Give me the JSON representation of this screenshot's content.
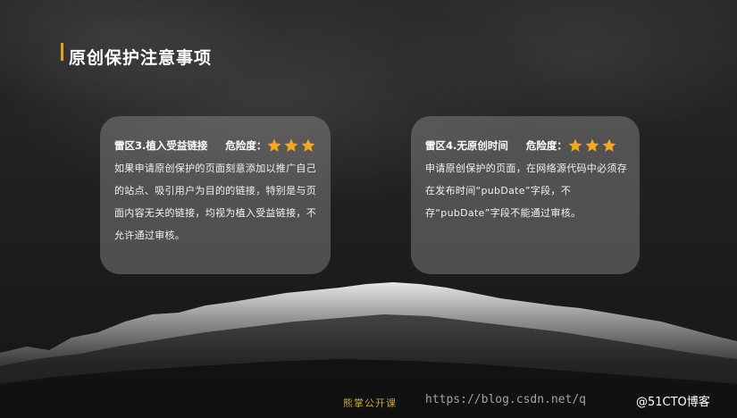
{
  "slide": {
    "title": "原创保护注意事项",
    "accent_color": "#e0a020",
    "star_color": "#f5a623"
  },
  "cards": [
    {
      "heading": "雷区3.植入受益链接",
      "risk_label": "危险度：",
      "stars": 3,
      "body": "如果申请原创保护的页面刻意添加以推广自己的站点、吸引用户为目的的链接，特别是与页面内容无关的链接，均视为植入受益链接，不允许通过审核。"
    },
    {
      "heading": "雷区4.无原创时间",
      "risk_label": "危险度：",
      "stars": 3,
      "body": "申请原创保护的页面，在网络源代码中必须存在发布时间“pubDate”字段，不存“pubDate”字段不能通过审核。"
    }
  ],
  "footer": {
    "brand": "熊掌公开课",
    "watermark_url": "https://blog.csdn.net/q",
    "watermark_site": "@51CTO博客"
  }
}
